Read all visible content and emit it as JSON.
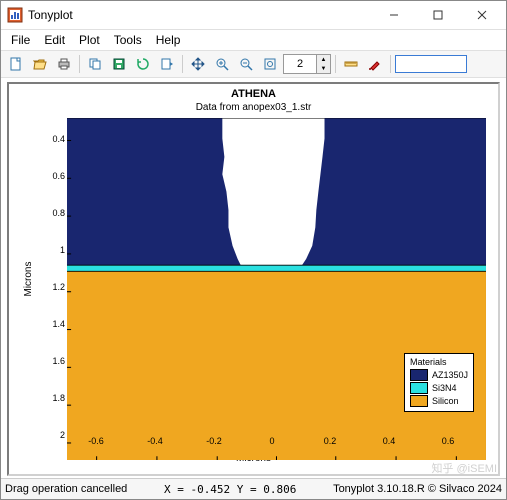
{
  "window": {
    "title": "Tonyplot"
  },
  "menu": [
    "File",
    "Edit",
    "Plot",
    "Tools",
    "Help"
  ],
  "toolbar": {
    "spin_value": "2"
  },
  "plot": {
    "title": "ATHENA",
    "subtitle": "Data from anopex03_1.str",
    "ylabel": "Microns",
    "xlabel": "Microns",
    "yticks": [
      "0.4",
      "0.6",
      "0.8",
      "1",
      "1.2",
      "1.4",
      "1.6",
      "1.8",
      "2"
    ],
    "xticks": [
      "-0.6",
      "-0.4",
      "-0.2",
      "0",
      "0.2",
      "0.4",
      "0.6"
    ]
  },
  "legend": {
    "title": "Materials",
    "items": [
      {
        "label": "AZ1350J",
        "color": "#19266f"
      },
      {
        "label": "Si3N4",
        "color": "#2be0e0"
      },
      {
        "label": "Silicon",
        "color": "#f0a720"
      }
    ]
  },
  "chart_data": {
    "type": "area",
    "xrange": [
      -0.7,
      0.7
    ],
    "yrange": [
      0.28,
      2.1
    ],
    "y_inverted": true,
    "layers": [
      {
        "material": "Silicon",
        "color": "#f0a720",
        "y_top": 1.1,
        "y_bottom": 2.1,
        "x_left": -0.7,
        "x_right": 0.7
      },
      {
        "material": "Si3N4",
        "color": "#2be0e0",
        "y_top": 1.07,
        "y_bottom": 1.1,
        "x_left": -0.7,
        "x_right": 0.7
      },
      {
        "material": "AZ1350J",
        "color": "#19266f",
        "side": "left",
        "y_top": 0.29,
        "y_bottom": 1.07,
        "outer_x": -0.7,
        "inner_edge": [
          [
            -0.18,
            0.29
          ],
          [
            -0.18,
            0.4
          ],
          [
            -0.17,
            0.5
          ],
          [
            -0.17,
            0.6
          ],
          [
            -0.15,
            0.7
          ],
          [
            -0.14,
            0.8
          ],
          [
            -0.14,
            0.9
          ],
          [
            -0.12,
            1.0
          ],
          [
            -0.1,
            1.06
          ],
          [
            -0.1,
            1.07
          ]
        ]
      },
      {
        "material": "AZ1350J",
        "color": "#19266f",
        "side": "right",
        "y_top": 0.29,
        "y_bottom": 1.07,
        "outer_x": 0.7,
        "inner_edge": [
          [
            0.16,
            0.29
          ],
          [
            0.16,
            0.4
          ],
          [
            0.15,
            0.5
          ],
          [
            0.14,
            0.6
          ],
          [
            0.13,
            0.7
          ],
          [
            0.12,
            0.8
          ],
          [
            0.12,
            0.9
          ],
          [
            0.1,
            1.0
          ],
          [
            0.08,
            1.06
          ],
          [
            0.08,
            1.07
          ]
        ]
      }
    ]
  },
  "status": {
    "left": "Drag operation cancelled",
    "coords": "X = -0.452 Y = 0.806",
    "right": "Tonyplot 3.10.18.R © Silvaco 2024"
  },
  "watermark": "知乎 @iSEMI"
}
